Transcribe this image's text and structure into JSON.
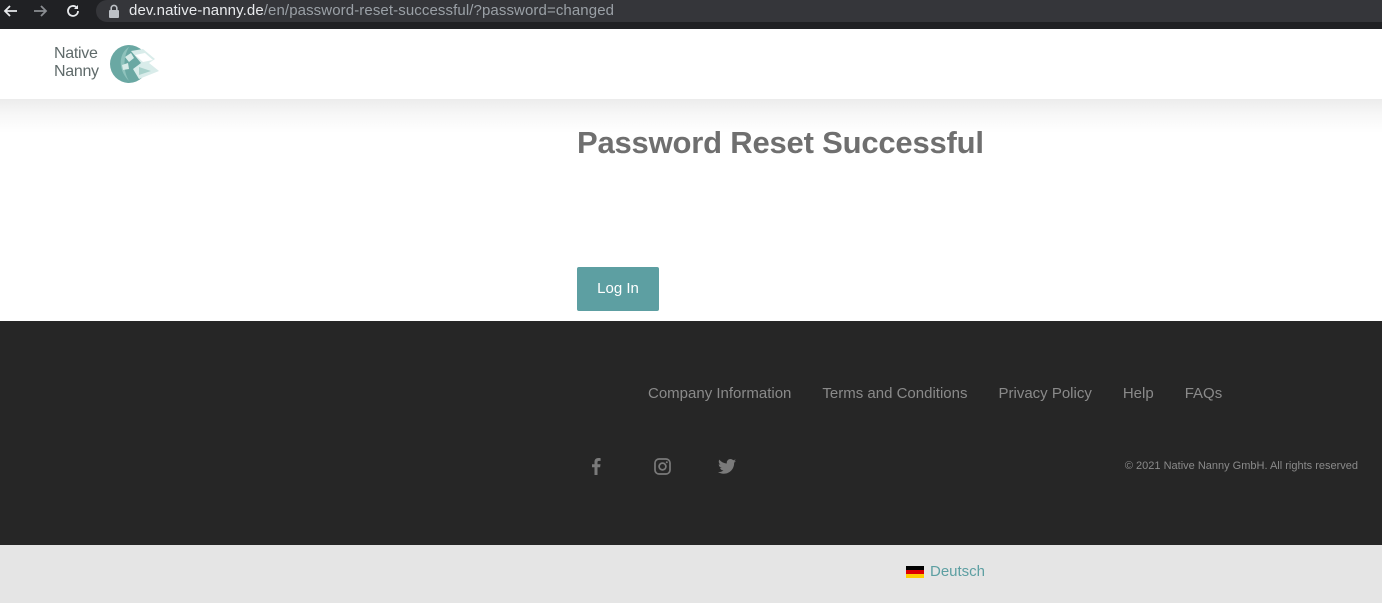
{
  "browser": {
    "url_host": "dev.native-nanny.de",
    "url_path": "/en/password-reset-successful/?password=changed",
    "back_icon": "arrow-left-icon",
    "forward_icon": "arrow-right-icon",
    "reload_icon": "reload-icon",
    "lock_icon": "lock-icon"
  },
  "header": {
    "logo_line1": "Native",
    "logo_line2": "Nanny",
    "logo_color": "#6aa8a3"
  },
  "main": {
    "title": "Password Reset Successful",
    "login_button_label": "Log In",
    "accent_color": "#5d9fa2"
  },
  "footer": {
    "links": [
      {
        "label": "Company Information"
      },
      {
        "label": "Terms and Conditions"
      },
      {
        "label": "Privacy Policy"
      },
      {
        "label": "Help"
      },
      {
        "label": "FAQs"
      }
    ],
    "social": [
      {
        "icon": "facebook-icon"
      },
      {
        "icon": "instagram-icon"
      },
      {
        "icon": "twitter-icon"
      }
    ],
    "copyright": "© 2021 Native Nanny GmbH. All rights reserved",
    "background_color": "#262626"
  },
  "language": {
    "label": "Deutsch",
    "flag_icon": "german-flag-icon"
  }
}
